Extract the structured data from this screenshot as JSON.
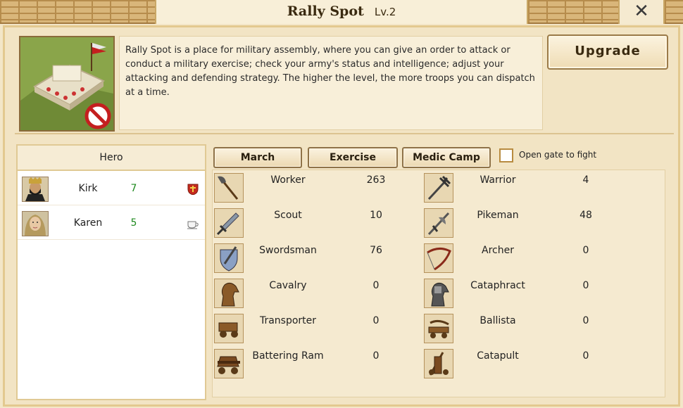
{
  "title": {
    "name": "Rally Spot",
    "level": "Lv.2"
  },
  "close": {
    "glyph": "✕"
  },
  "building": {
    "description": "Rally Spot is a place for military assembly, where you can give an order to attack or conduct a military exercise; check your army's status and intelligence; adjust your attacking and defending strategy. The higher the level, the more troops you can dispatch at a time.",
    "upgrade_label": "Upgrade"
  },
  "heroes": {
    "header": "Hero",
    "rows": [
      {
        "name": "Kirk",
        "level": "7",
        "status_icon": "shield-icon"
      },
      {
        "name": "Karen",
        "level": "5",
        "status_icon": "teacup-icon"
      }
    ]
  },
  "tabs": [
    {
      "label": "March"
    },
    {
      "label": "Exercise"
    },
    {
      "label": "Medic Camp"
    }
  ],
  "gate": {
    "label": "Open gate to fight",
    "checked": false
  },
  "troops": [
    {
      "name": "Worker",
      "count": "263",
      "icon": "axe-icon"
    },
    {
      "name": "Warrior",
      "count": "4",
      "icon": "trident-icon"
    },
    {
      "name": "Scout",
      "count": "10",
      "icon": "dagger-icon"
    },
    {
      "name": "Pikeman",
      "count": "48",
      "icon": "halberd-icon"
    },
    {
      "name": "Swordsman",
      "count": "76",
      "icon": "sword-shield-icon"
    },
    {
      "name": "Archer",
      "count": "0",
      "icon": "bow-icon"
    },
    {
      "name": "Cavalry",
      "count": "0",
      "icon": "horse-icon"
    },
    {
      "name": "Cataphract",
      "count": "0",
      "icon": "armored-horse-icon"
    },
    {
      "name": "Transporter",
      "count": "0",
      "icon": "cart-icon"
    },
    {
      "name": "Ballista",
      "count": "0",
      "icon": "ballista-icon"
    },
    {
      "name": "Battering Ram",
      "count": "0",
      "icon": "ram-icon"
    },
    {
      "name": "Catapult",
      "count": "0",
      "icon": "catapult-icon"
    }
  ],
  "colors": {
    "level_green": "#1f8a1f",
    "accent_gold": "#b88b40"
  }
}
